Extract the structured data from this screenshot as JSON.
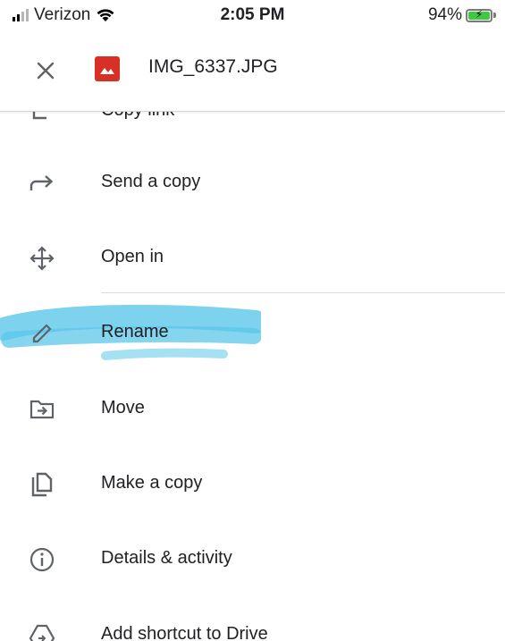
{
  "status_bar": {
    "carrier": "Verizon",
    "time": "2:05 PM",
    "battery": "94%"
  },
  "header": {
    "file_name": "IMG_6337.JPG",
    "close_icon": "close-icon",
    "file_icon": "image-file-icon"
  },
  "menu": {
    "items": [
      {
        "label": "Copy link",
        "icon": "link-icon"
      },
      {
        "label": "Send a copy",
        "icon": "forward-arrow-icon"
      },
      {
        "label": "Open in",
        "icon": "open-in-move-icon"
      },
      {
        "label": "Rename",
        "icon": "pencil-icon"
      },
      {
        "label": "Move",
        "icon": "move-folder-icon"
      },
      {
        "label": "Make a copy",
        "icon": "copy-icon"
      },
      {
        "label": "Details & activity",
        "icon": "info-icon"
      },
      {
        "label": "Add shortcut to Drive",
        "icon": "drive-shortcut-icon"
      }
    ]
  },
  "colors": {
    "highlight": "#5cc7ea",
    "file_icon_bg": "#d93025",
    "icon_gray": "#5f6368",
    "battery_fill": "#43c742"
  }
}
